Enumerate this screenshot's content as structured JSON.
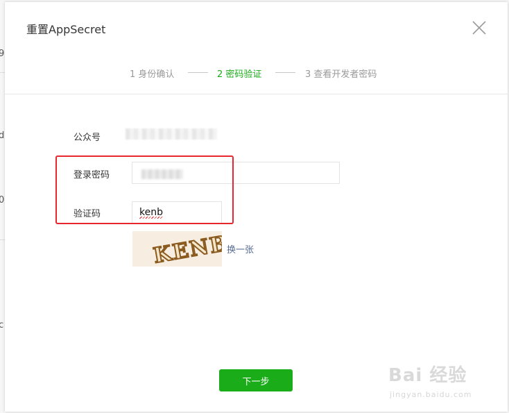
{
  "dialog": {
    "title": "重置AppSecret",
    "steps": [
      {
        "label": "1 身份确认",
        "state": "done"
      },
      {
        "label": "2 密码验证",
        "state": "active"
      },
      {
        "label": "3 查看开发者密码",
        "state": "pending"
      }
    ],
    "form": {
      "account_label": "公众号",
      "password_label": "登录密码",
      "captcha_label": "验证码",
      "captcha_value": "kenb",
      "captcha_image_text": "KENB",
      "captcha_refresh": "换一张"
    },
    "next_label": "下一步"
  },
  "background": {
    "fragments": [
      "9",
      "d",
      "0",
      "c"
    ]
  },
  "watermark": {
    "logo_text": "Bai 经验",
    "sub_text": "jingyan.baidu.com"
  },
  "colors": {
    "accent_green": "#1aad19",
    "highlight_red": "#e8262d",
    "link_blue": "#576b95"
  }
}
